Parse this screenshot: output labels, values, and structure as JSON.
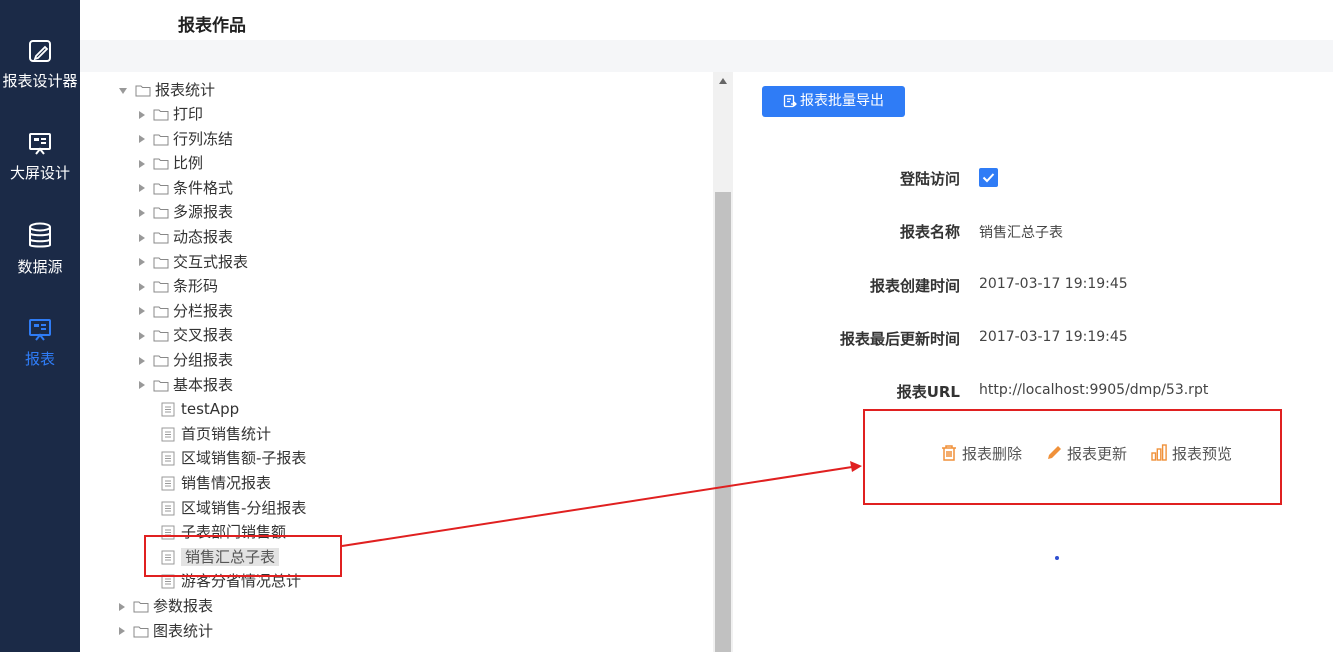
{
  "sidebar": {
    "items": [
      {
        "label": "报表设计器",
        "icon": "edit-icon"
      },
      {
        "label": "大屏设计",
        "icon": "screen-icon"
      },
      {
        "label": "数据源",
        "icon": "database-icon"
      },
      {
        "label": "报表",
        "icon": "report-icon"
      }
    ]
  },
  "header": {
    "title": "报表作品"
  },
  "tree": {
    "parent": "报表统计",
    "folders": [
      "打印",
      "行列冻结",
      "比例",
      "条件格式",
      "多源报表",
      "动态报表",
      "交互式报表",
      "条形码",
      "分栏报表",
      "交叉报表",
      "分组报表",
      "基本报表"
    ],
    "files": [
      "testApp",
      "首页销售统计",
      "区域销售额-子报表",
      "销售情况报表",
      "区域销售-分组报表",
      "子表部门销售额",
      "销售汇总子表",
      "游客分省情况总计"
    ],
    "siblings": [
      "参数报表",
      "图表统计"
    ],
    "selected": "销售汇总子表"
  },
  "toolbar": {
    "export_label": "报表批量导出"
  },
  "details": {
    "login_label": "登陆访问",
    "login_checked": true,
    "name_label": "报表名称",
    "name_value": "销售汇总子表",
    "created_label": "报表创建时间",
    "created_value": "2017-03-17 19:19:45",
    "updated_label": "报表最后更新时间",
    "updated_value": "2017-03-17 19:19:45",
    "url_label": "报表URL",
    "url_value": "http://localhost:9905/dmp/53.rpt"
  },
  "actions": {
    "delete_label": "报表删除",
    "update_label": "报表更新",
    "preview_label": "报表预览"
  },
  "colors": {
    "sidebar_bg": "#1b2a47",
    "accent": "#2f7cf6",
    "action_orange": "#f0913a",
    "annotation_red": "#e02020"
  }
}
